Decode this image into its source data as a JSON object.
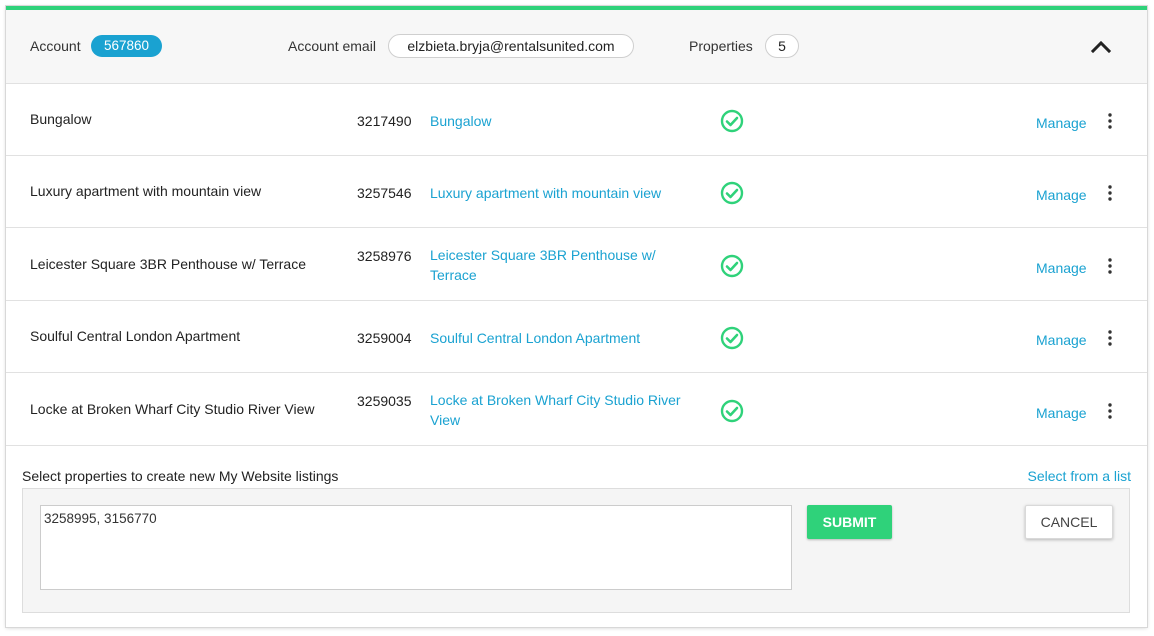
{
  "header": {
    "account_label": "Account",
    "account_id": "567860",
    "email_label": "Account email",
    "email": "elzbieta.bryja@rentalsunited.com",
    "properties_label": "Properties",
    "properties_count": "5",
    "collapse_icon": "chevron-up-icon"
  },
  "properties": [
    {
      "name": "Bungalow",
      "id": "3217490",
      "link": "Bungalow",
      "status_icon": "check-circle-icon",
      "manage": "Manage",
      "menu_icon": "more-vertical-icon"
    },
    {
      "name": "Luxury apartment with mountain view",
      "id": "3257546",
      "link": "Luxury apartment with mountain view",
      "status_icon": "check-circle-icon",
      "manage": "Manage",
      "menu_icon": "more-vertical-icon"
    },
    {
      "name": "Leicester Square 3BR Penthouse w/ Terrace",
      "id": "3258976",
      "link": "Leicester Square 3BR Penthouse w/ Terrace",
      "status_icon": "check-circle-icon",
      "manage": "Manage",
      "menu_icon": "more-vertical-icon"
    },
    {
      "name": "Soulful Central London Apartment",
      "id": "3259004",
      "link": "Soulful Central London Apartment",
      "status_icon": "check-circle-icon",
      "manage": "Manage",
      "menu_icon": "more-vertical-icon"
    },
    {
      "name": "Locke at Broken Wharf City Studio River View",
      "id": "3259035",
      "link": "Locke at Broken Wharf City Studio River View",
      "status_icon": "check-circle-icon",
      "manage": "Manage",
      "menu_icon": "more-vertical-icon"
    }
  ],
  "footer": {
    "title": "Select properties to create new My Website listings",
    "select_link": "Select from a list",
    "input_value": "3258995, 3156770",
    "submit_label": "SUBMIT",
    "cancel_label": "CANCEL"
  },
  "colors": {
    "accent_green": "#2fd27a",
    "link_blue": "#1aa2d1",
    "badge_blue": "#1aa2d1"
  }
}
